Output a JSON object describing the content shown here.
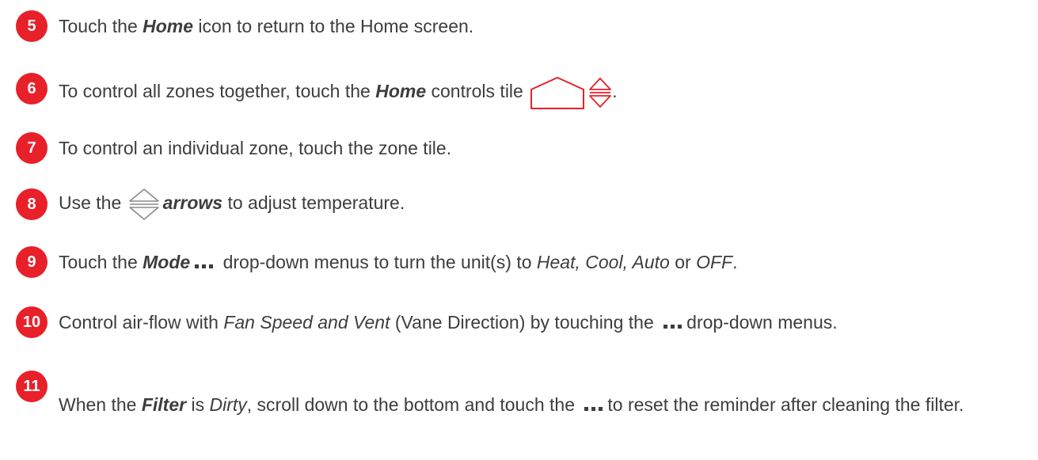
{
  "brand_color": "#e8202a",
  "text_color": "#3d3d3f",
  "steps": [
    {
      "number": "5",
      "parts": [
        "Touch the ",
        "Home",
        " icon to return to the Home screen."
      ]
    },
    {
      "number": "6",
      "parts": [
        "To control all zones together, touch the ",
        "Home",
        " controls tile ",
        "."
      ],
      "icons": [
        "home-outline-icon",
        "up-down-arrows-icon"
      ]
    },
    {
      "number": "7",
      "parts": [
        "To control an individual zone, touch the zone tile."
      ]
    },
    {
      "number": "8",
      "parts": [
        "Use the ",
        "arrows",
        " to adjust temperature."
      ],
      "icons": [
        "up-down-arrows-icon"
      ]
    },
    {
      "number": "9",
      "parts": [
        "Touch the ",
        "Mode",
        " drop-down menus to turn the unit(s) to ",
        "Heat, Cool, Auto",
        " or ",
        "OFF",
        "."
      ],
      "icons": [
        "more-dots-icon"
      ]
    },
    {
      "number": "10",
      "parts": [
        "Control air-flow with ",
        "Fan Speed and Vent",
        " (Vane Direction) by touching the ",
        "drop-down menus."
      ],
      "icons": [
        "more-dots-icon"
      ]
    },
    {
      "number": "11",
      "parts": [
        "When the ",
        "Filter",
        " is ",
        "Dirty",
        ", scroll down to the bottom and touch the ",
        "to reset the reminder after cleaning the filter."
      ],
      "icons": [
        "more-dots-icon"
      ]
    }
  ]
}
